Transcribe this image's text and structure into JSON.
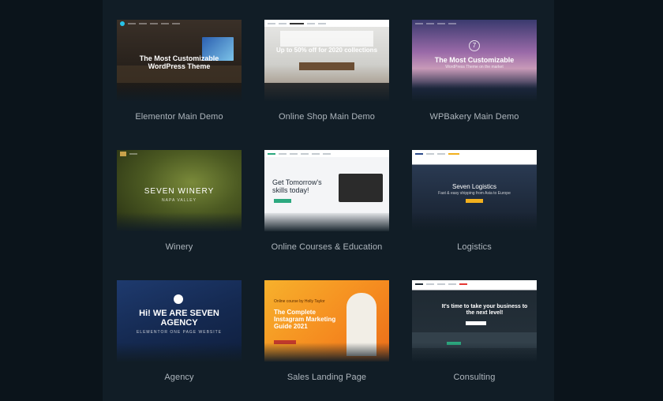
{
  "demos": [
    {
      "label": "Elementor Main Demo",
      "hero": "The Most Customizable WordPress Theme"
    },
    {
      "label": "Online Shop Main Demo",
      "hero": "Up to 50% off for 2020 collections"
    },
    {
      "label": "WPBakery Main Demo",
      "hero": "The Most Customizable",
      "sub": "WordPress Theme on the market"
    },
    {
      "label": "Winery",
      "hero": "SEVEN WINERY",
      "sub": "NAPA VALLEY"
    },
    {
      "label": "Online Courses & Education",
      "hero": "Get Tomorrow's skills today!"
    },
    {
      "label": "Logistics",
      "hero": "Seven Logistics",
      "sub": "Fast & easy shipping from Asia to Europe"
    },
    {
      "label": "Agency",
      "hero": "Hi! WE ARE SEVEN AGENCY",
      "sub": "ELEMENTOR ONE PAGE WEBSITE"
    },
    {
      "label": "Sales Landing Page",
      "hero": "The Complete Instagram Marketing Guide 2021",
      "sub": "Online course by Holly Taylor"
    },
    {
      "label": "Consulting",
      "hero": "It's time to take your business to the next level!"
    }
  ],
  "colors": {
    "page_bg": "#0b141b",
    "panel_bg": "#111d26",
    "label": "#aeb6bd"
  }
}
